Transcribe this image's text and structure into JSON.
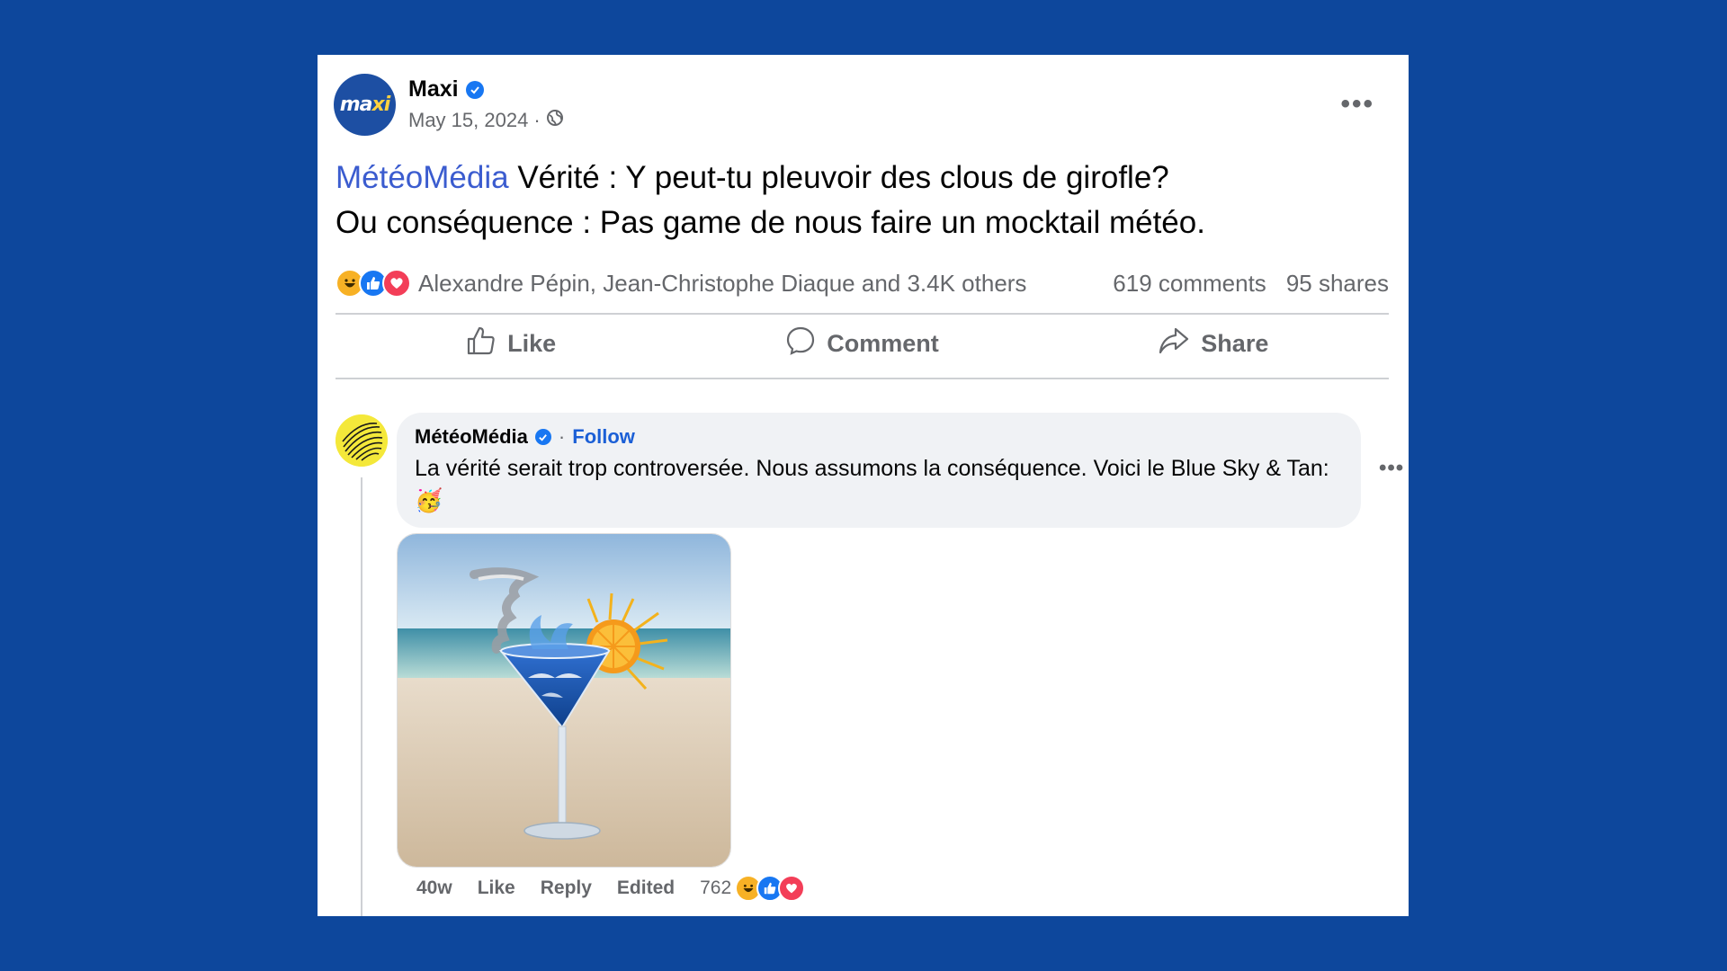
{
  "post": {
    "author": "Maxi",
    "avatar_text_a": "ma",
    "avatar_text_b": "xi",
    "date": "May 15, 2024",
    "date_separator": "·",
    "privacy_icon": "globe-icon",
    "mention": "MétéoMédia",
    "text_line1_rest": " Vérité : Y peut-tu pleuvoir des clous de girofle?",
    "text_line2": "Ou conséquence : Pas game de nous faire un mocktail météo.",
    "reactions": [
      "haha",
      "like",
      "love"
    ],
    "reaction_names": "Alexandre Pépin, Jean-Christophe Diaque and 3.4K others",
    "comments_count": "619 comments",
    "shares_count": "95 shares"
  },
  "actions": {
    "like": "Like",
    "comment": "Comment",
    "share": "Share"
  },
  "comment": {
    "author": "MétéoMédia",
    "separator": "·",
    "follow": "Follow",
    "text": "La vérité serait trop controversée. Nous assumons la conséquence. Voici le Blue Sky & Tan: 🥳",
    "time": "40w",
    "like": "Like",
    "reply": "Reply",
    "edited": "Edited",
    "reaction_count": "762"
  },
  "colors": {
    "background": "#0d479c",
    "mention": "#3b5ccf",
    "follow": "#1b5fd6",
    "verified": "#1877f2"
  }
}
